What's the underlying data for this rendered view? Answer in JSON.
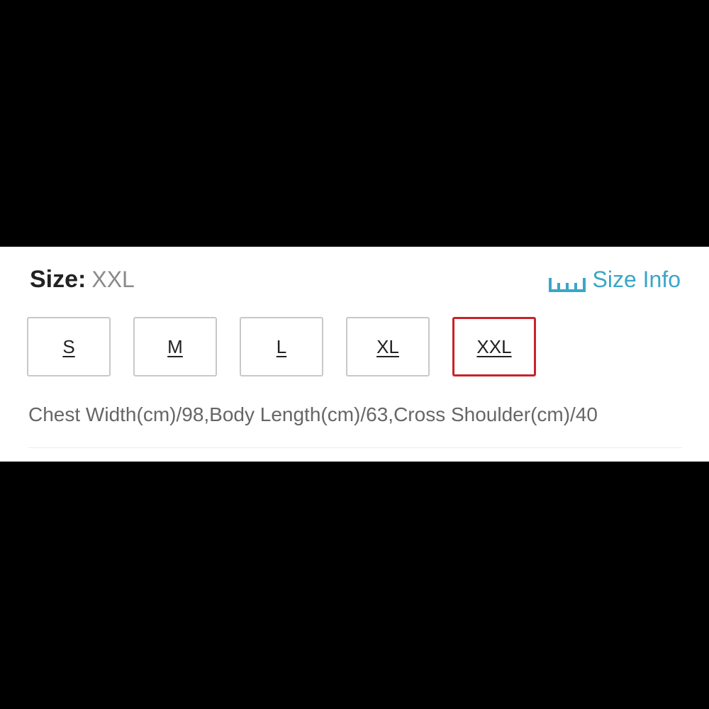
{
  "size_selector": {
    "label": "Size:",
    "selected_value": "XXL",
    "size_info_label": "Size Info",
    "size_info_icon": "ruler-icon",
    "options": [
      "S",
      "M",
      "L",
      "XL",
      "XXL"
    ],
    "selected_index": 4,
    "measurements": "Chest Width(cm)/98,Body Length(cm)/63,Cross Shoulder(cm)/40"
  },
  "colors": {
    "accent_link": "#3aa6c8",
    "selected_border": "#c8232c",
    "default_border": "#c8c8c8"
  }
}
